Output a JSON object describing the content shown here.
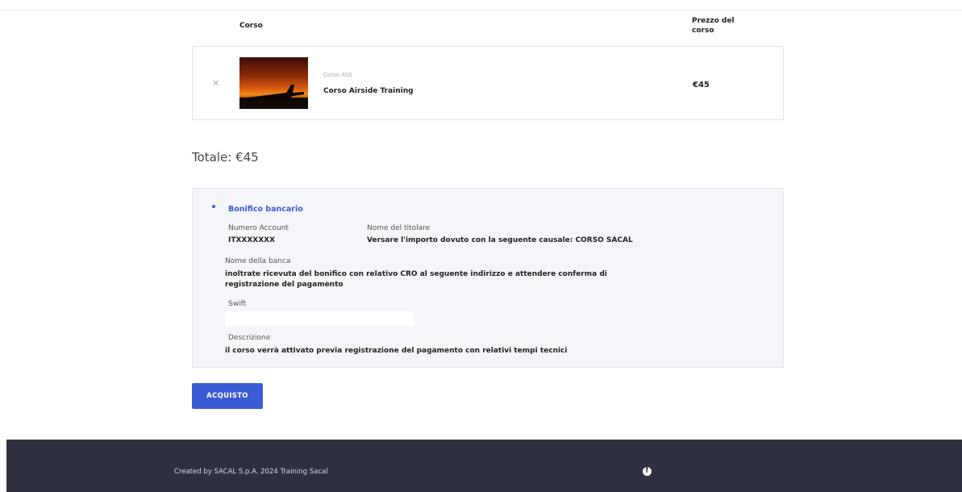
{
  "table": {
    "col_course": "Corso",
    "col_price": "Prezzo del corso"
  },
  "cart": {
    "items": [
      {
        "remove_icon": "×",
        "category": "Corso ASS",
        "name": "Corso Airside Training",
        "price": "€45"
      }
    ]
  },
  "total": "Totale: €45",
  "payment": {
    "method": "Bonifico bancario",
    "account_number_label": "Numero Account",
    "account_number_value": "ITXXXXXXX",
    "holder_label": "Nome del titolare",
    "holder_value": "Versare l'importo dovuto con la seguente causale: CORSO SACAL",
    "bank_label": "Nome della banca",
    "bank_value": "inoltrate ricevuta del bonifico con relativo CRO al seguente indirizzo e attendere conferma di registrazione del pagamento",
    "swift_label": "Swift",
    "swift_value": "",
    "description_label": "Descrizione",
    "description_value": "il corso verrà attivato previa registrazione del pagamento con relativi tempi tecnici"
  },
  "buy_button": "ACQUISTO",
  "footer": {
    "text": "Created by SACAL S.p.A. 2024 Training Sacal",
    "social_icon": "facebook-icon"
  },
  "colors": {
    "accent": "#3b5bd6",
    "footer_bg": "#2e3040",
    "pay_box_bg": "#f4f6f9"
  }
}
